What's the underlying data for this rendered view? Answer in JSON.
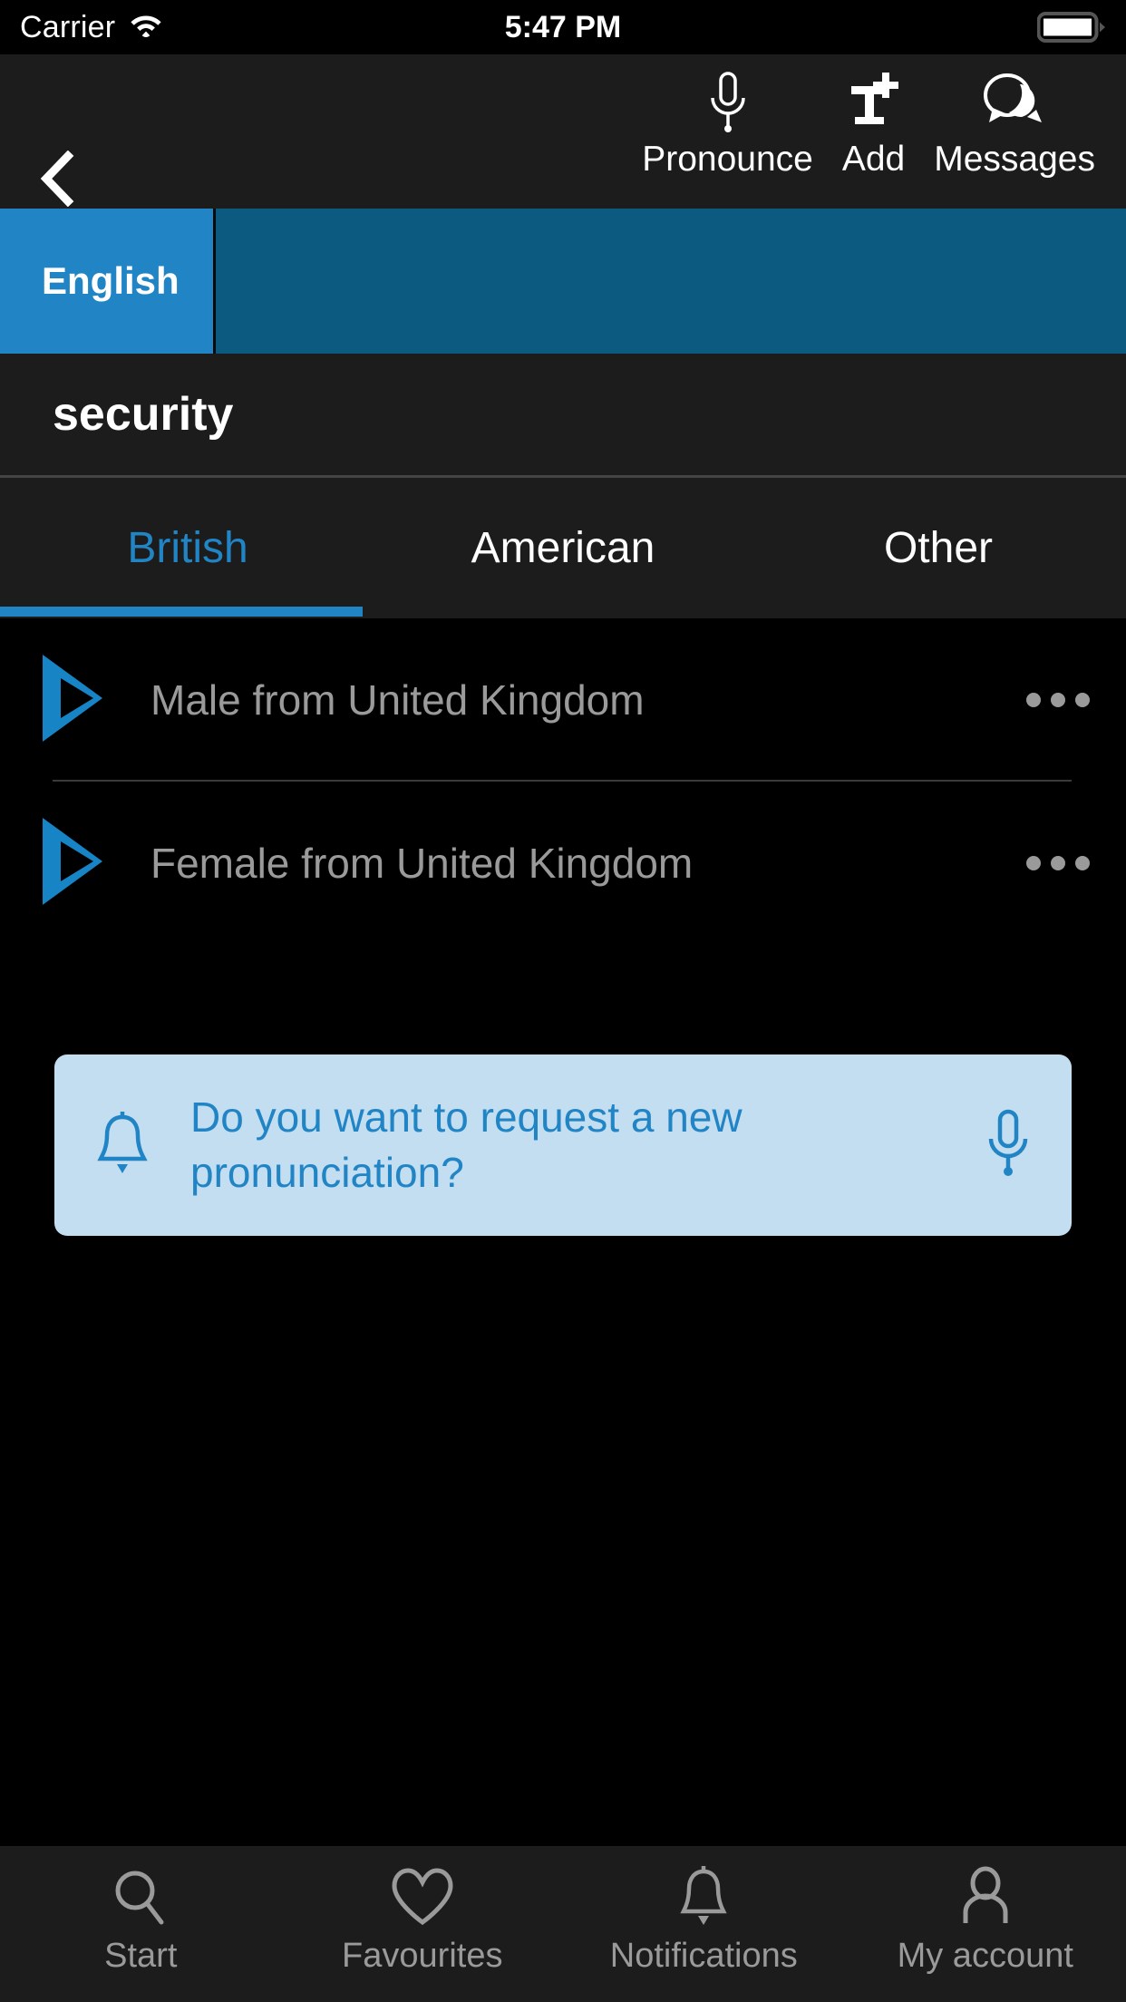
{
  "colors": {
    "accent_blue": "#2185c5",
    "strip_blue": "#0d5a80",
    "card_blue": "#c3ddf1",
    "bg_black": "#000000",
    "bar_dark": "#1c1c1c",
    "muted_gray": "#9a9a9a"
  },
  "status_bar": {
    "carrier": "Carrier",
    "wifi_icon": "wifi-icon",
    "time": "5:47 PM",
    "battery_icon": "battery-full-icon"
  },
  "toolbar": {
    "back_icon": "chevron-left-icon",
    "actions": [
      {
        "label": "Pronounce",
        "icon": "microphone-icon"
      },
      {
        "label": "Add",
        "icon": "add-text-icon"
      },
      {
        "label": "Messages",
        "icon": "speech-bubbles-icon"
      }
    ]
  },
  "language_strip": {
    "selected": "English"
  },
  "word": {
    "text": "security"
  },
  "accent_tabs": {
    "items": [
      {
        "label": "British",
        "active": true
      },
      {
        "label": "American",
        "active": false
      },
      {
        "label": "Other",
        "active": false
      }
    ]
  },
  "pronunciations": {
    "rows": [
      {
        "label": "Male from United Kingdom",
        "play_icon": "play-icon",
        "more_icon": "more-horizontal-icon"
      },
      {
        "label": "Female from United Kingdom",
        "play_icon": "play-icon",
        "more_icon": "more-horizontal-icon"
      }
    ]
  },
  "request_card": {
    "bell_icon": "bell-icon",
    "text": "Do you want to request a new pronunciation?",
    "mic_icon": "microphone-icon"
  },
  "bottom_nav": {
    "items": [
      {
        "label": "Start",
        "icon": "search-icon"
      },
      {
        "label": "Favourites",
        "icon": "heart-icon"
      },
      {
        "label": "Notifications",
        "icon": "bell-icon"
      },
      {
        "label": "My account",
        "icon": "person-icon"
      }
    ]
  }
}
